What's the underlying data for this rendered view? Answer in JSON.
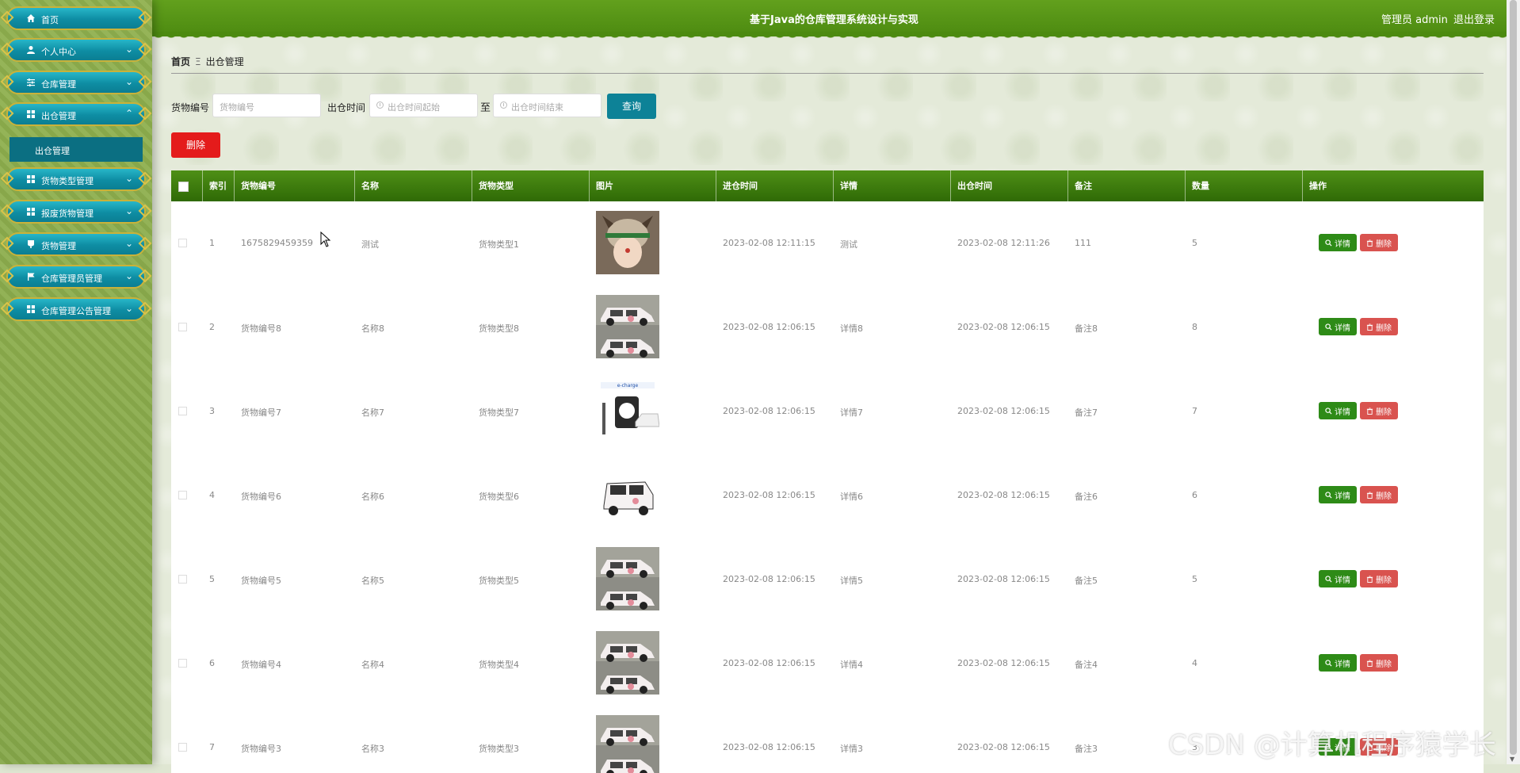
{
  "header": {
    "title": "基于Java的仓库管理系统设计与实现",
    "user": "管理员 admin",
    "logout": "退出登录"
  },
  "sidebar": {
    "items": [
      {
        "label": "首页",
        "icon": "home-icon"
      },
      {
        "label": "个人中心",
        "icon": "user-icon"
      },
      {
        "label": "仓库管理",
        "icon": "sliders-icon"
      },
      {
        "label": "出仓管理",
        "icon": "grid-icon",
        "expanded": true
      },
      {
        "label": "货物类型管理",
        "icon": "grid-icon"
      },
      {
        "label": "报废货物管理",
        "icon": "grid-icon"
      },
      {
        "label": "货物管理",
        "icon": "cup-icon"
      },
      {
        "label": "仓库管理员管理",
        "icon": "flag-icon"
      },
      {
        "label": "仓库管理公告管理",
        "icon": "grid-icon"
      }
    ],
    "submenu_active": "出仓管理"
  },
  "breadcrumb": {
    "home": "首页",
    "sep": "Ξ",
    "current": "出仓管理"
  },
  "filters": {
    "code_label": "货物编号",
    "code_placeholder": "货物编号",
    "time_label": "出仓时间",
    "start_placeholder": "出仓时间起始",
    "to": "至",
    "end_placeholder": "出仓时间结束",
    "query_button": "查询"
  },
  "delete_button": "删除",
  "table": {
    "columns": [
      "索引",
      "货物编号",
      "名称",
      "货物类型",
      "图片",
      "进仓时间",
      "详情",
      "出仓时间",
      "备注",
      "数量",
      "操作"
    ],
    "detail_button": "详情",
    "delete_button": "删除",
    "rows": [
      {
        "index": "1",
        "code": "1675829459359",
        "name": "测试",
        "type": "货物类型1",
        "image": "child-photo",
        "in_time": "2023-02-08 12:11:15",
        "detail": "测试",
        "out_time": "2023-02-08 12:11:26",
        "note": "111",
        "qty": "5"
      },
      {
        "index": "2",
        "code": "货物编号8",
        "name": "名称8",
        "type": "货物类型8",
        "image": "car-photo",
        "in_time": "2023-02-08 12:06:15",
        "detail": "详情8",
        "out_time": "2023-02-08 12:06:15",
        "note": "备注8",
        "qty": "8"
      },
      {
        "index": "3",
        "code": "货物编号7",
        "name": "名称7",
        "type": "货物类型7",
        "image": "charger-photo",
        "in_time": "2023-02-08 12:06:15",
        "detail": "详情7",
        "out_time": "2023-02-08 12:06:15",
        "note": "备注7",
        "qty": "7"
      },
      {
        "index": "4",
        "code": "货物编号6",
        "name": "名称6",
        "type": "货物类型6",
        "image": "car-single-photo",
        "in_time": "2023-02-08 12:06:15",
        "detail": "详情6",
        "out_time": "2023-02-08 12:06:15",
        "note": "备注6",
        "qty": "6"
      },
      {
        "index": "5",
        "code": "货物编号5",
        "name": "名称5",
        "type": "货物类型5",
        "image": "car-photo",
        "in_time": "2023-02-08 12:06:15",
        "detail": "详情5",
        "out_time": "2023-02-08 12:06:15",
        "note": "备注5",
        "qty": "5"
      },
      {
        "index": "6",
        "code": "货物编号4",
        "name": "名称4",
        "type": "货物类型4",
        "image": "car-photo",
        "in_time": "2023-02-08 12:06:15",
        "detail": "详情4",
        "out_time": "2023-02-08 12:06:15",
        "note": "备注4",
        "qty": "4"
      },
      {
        "index": "7",
        "code": "货物编号3",
        "name": "名称3",
        "type": "货物类型3",
        "image": "car-photo",
        "in_time": "2023-02-08 12:06:15",
        "detail": "详情3",
        "out_time": "2023-02-08 12:06:15",
        "note": "备注3",
        "qty": "3"
      }
    ]
  },
  "watermark": "CSDN @计算机程序猿学长",
  "colors": {
    "header": "#4c8a10",
    "menu": "#0e8da3",
    "table_head": "#2f6a06",
    "detail_button": "#2e8b17",
    "delete_button": "#d9534f",
    "top_delete": "#e41b1b",
    "query": "#0d8297"
  }
}
